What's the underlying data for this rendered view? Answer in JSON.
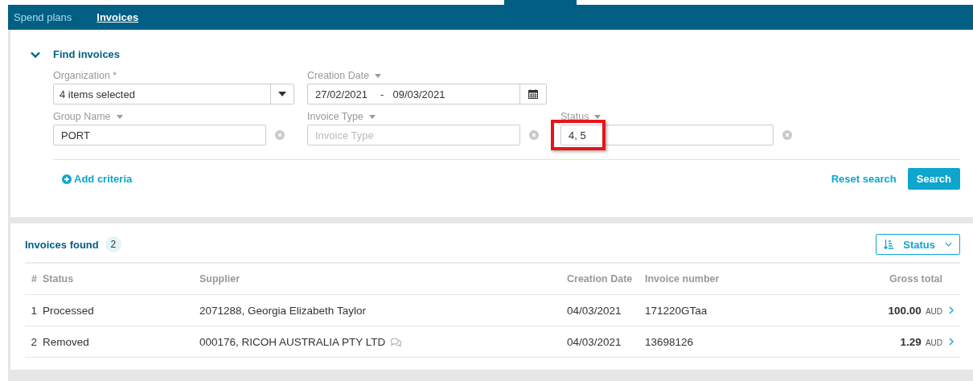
{
  "nav": {
    "tabs": [
      {
        "label": "Spend plans",
        "selected": false
      },
      {
        "label": "Invoices",
        "selected": true
      }
    ]
  },
  "filters": {
    "title": "Find invoices",
    "expanded": true,
    "organization": {
      "label": "Organization *",
      "value": "4 items selected"
    },
    "creation_date": {
      "label": "Creation Date",
      "from": "27/02/2021",
      "separator": "-",
      "to": "09/03/2021"
    },
    "criteria": [
      {
        "label": "Group Name",
        "value": "PORT",
        "highlighted": false
      },
      {
        "label": "Invoice Type",
        "placeholder": "Invoice Type",
        "highlighted": false
      },
      {
        "label": "Status",
        "value": "4, 5",
        "highlighted": true
      }
    ],
    "add_criteria": "Add criteria",
    "reset": "Reset search",
    "search": "Search"
  },
  "results": {
    "title": "Invoices found",
    "count": "2",
    "sort": "Status",
    "columns": [
      "#",
      "Status",
      "Supplier",
      "Creation Date",
      "Invoice number",
      "Gross total"
    ],
    "rows": [
      {
        "num": "1",
        "status": "Processed",
        "supplier": "2071288, Georgia Elizabeth Taylor",
        "has_comments": false,
        "date": "04/03/2021",
        "invoice": "171220GTaa",
        "total": "100.00",
        "currency": "AUD"
      },
      {
        "num": "2",
        "status": "Removed",
        "supplier": "000176, RICOH AUSTRALIA PTY LTD",
        "has_comments": true,
        "date": "04/03/2021",
        "invoice": "13698126",
        "total": "1.29",
        "currency": "AUD"
      }
    ]
  }
}
